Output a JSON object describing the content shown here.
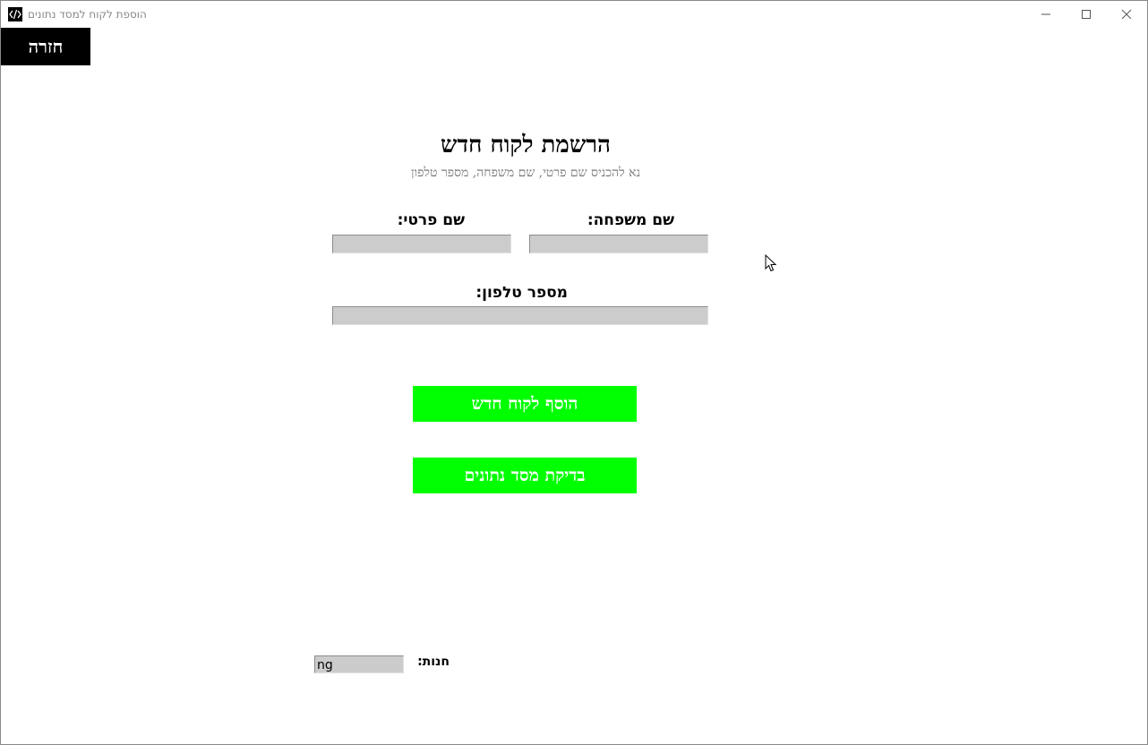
{
  "window": {
    "title": "הוספת לקוח למסד נתונים",
    "app_icon": "code-brackets-icon",
    "controls": [
      "minimize-icon",
      "maximize-icon",
      "close-icon"
    ]
  },
  "header": {
    "back_label": "חזרה"
  },
  "form": {
    "title": "הרשמת לקוח חדש",
    "subtitle": "נא להכניס שם פרטי, שם משפחה, מספר טלפון",
    "last_name_label": "שם משפחה:",
    "first_name_label": "שם פרטי:",
    "phone_label": "מספר טלפון:",
    "last_name_value": "",
    "first_name_value": "",
    "phone_value": ""
  },
  "actions": {
    "add_customer_label": "הוסף לקוח חדש",
    "check_db_label": "בדיקת מסד נתונים"
  },
  "store": {
    "label": "חנות:",
    "value": "ng"
  },
  "colors": {
    "button_green": "#00ff00",
    "back_button_bg": "#000000",
    "field_bg": "#cccccc",
    "subtitle_gray": "#7a7a7a"
  }
}
